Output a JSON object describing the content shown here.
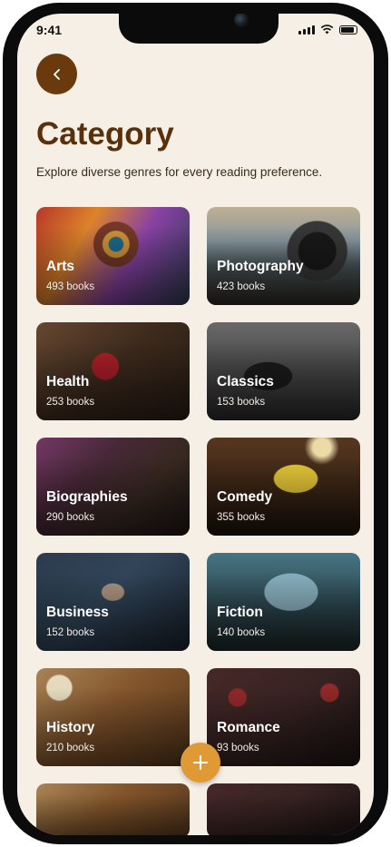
{
  "status_bar": {
    "time": "9:41"
  },
  "header": {
    "title": "Category",
    "subtitle": "Explore diverse genres for every reading preference."
  },
  "categories": [
    {
      "name": "Arts",
      "count": "493 books"
    },
    {
      "name": "Photography",
      "count": "423 books"
    },
    {
      "name": "Health",
      "count": "253 books"
    },
    {
      "name": "Classics",
      "count": "153 books"
    },
    {
      "name": "Biographies",
      "count": "290 books"
    },
    {
      "name": "Comedy",
      "count": "355 books"
    },
    {
      "name": "Business",
      "count": "152 books"
    },
    {
      "name": "Fiction",
      "count": "140 books"
    },
    {
      "name": "History",
      "count": "210 books"
    },
    {
      "name": "Romance",
      "count": "93 books"
    }
  ],
  "icons": {
    "back": "chevron-left-icon",
    "add": "plus-icon"
  },
  "colors": {
    "accent": "#6b3a0c",
    "fab": "#e09a35",
    "background": "#f6efe6"
  }
}
